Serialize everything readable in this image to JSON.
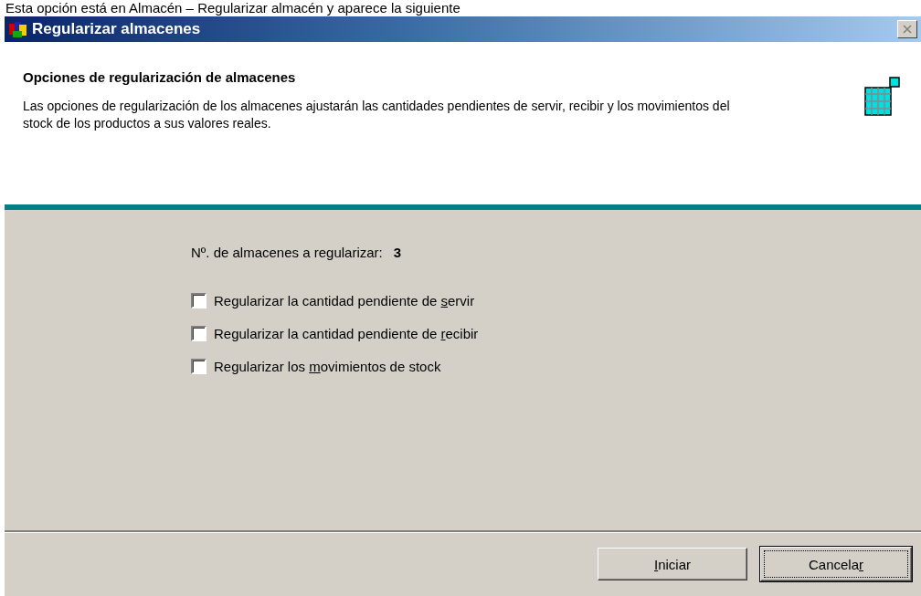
{
  "caption": "Esta opción está en Almacén – Regularizar almacén y aparece la siguiente",
  "window": {
    "title": "Regularizar almacenes"
  },
  "header": {
    "title": "Opciones de regularización de almacenes",
    "description": "Las opciones de  regularización de los almacenes ajustarán las cantidades pendientes de servir, recibir y los movimientos del stock de los productos a sus valores reales."
  },
  "count": {
    "label": "Nº. de almacenes a regularizar:",
    "value": "3"
  },
  "options": [
    {
      "before": "Regularizar la cantidad pendiente de ",
      "key": "s",
      "after": "ervir",
      "checked": false
    },
    {
      "before": "Regularizar la cantidad pendiente de ",
      "key": "r",
      "after": "ecibir",
      "checked": false
    },
    {
      "before": "Regularizar los ",
      "key": "m",
      "after": "ovimientos de stock",
      "checked": false
    }
  ],
  "buttons": [
    {
      "key": "I",
      "after": "niciar",
      "default": false
    },
    {
      "before": "Cancela",
      "key": "r",
      "default": true
    }
  ]
}
